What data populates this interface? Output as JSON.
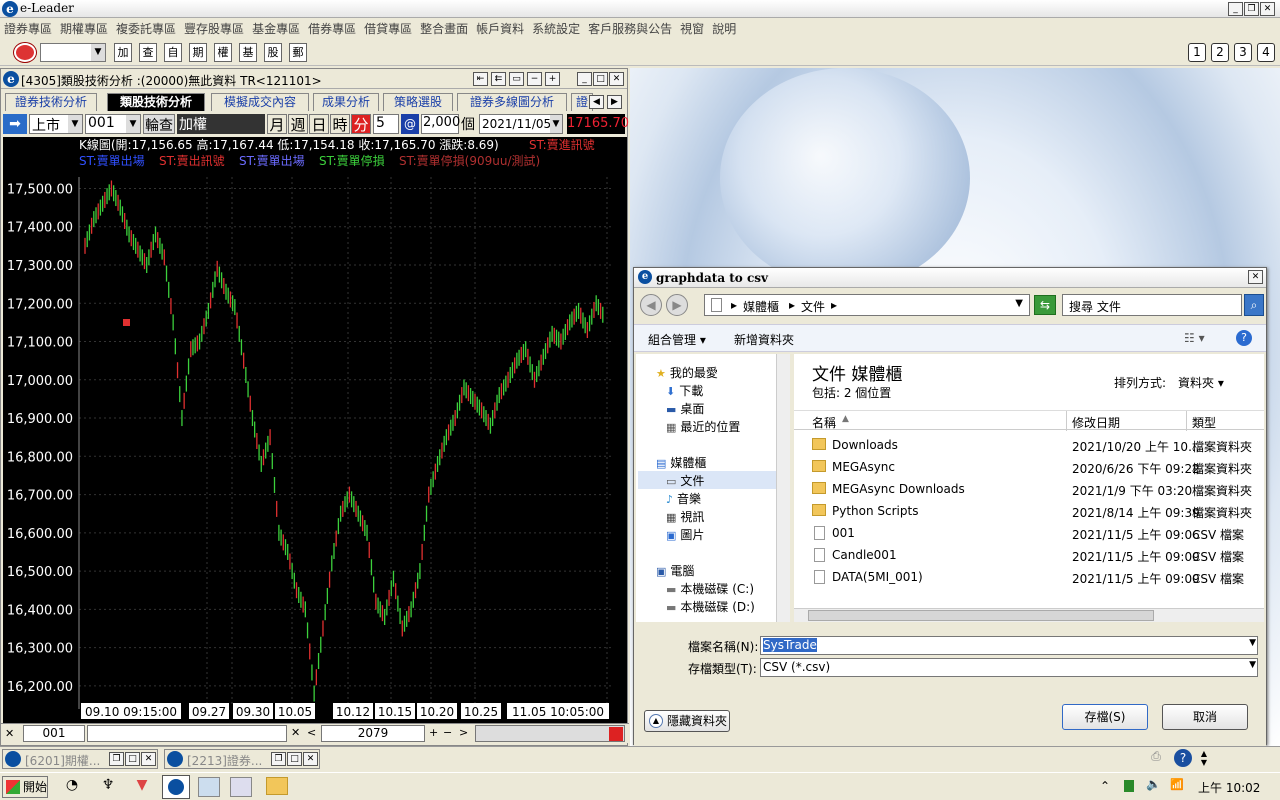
{
  "app": {
    "title": "e-Leader"
  },
  "menu": [
    "證券專區",
    "期權專區",
    "複委託專區",
    "豐存股專區",
    "基金專區",
    "借券專區",
    "借貸專區",
    "整合畫面",
    "帳戶資料",
    "系統設定",
    "客戶服務與公告",
    "視窗",
    "說明"
  ],
  "toolbar": {
    "icons": [
      "加",
      "查",
      "自",
      "期",
      "權",
      "基",
      "股",
      "郵"
    ],
    "numbers": [
      "1",
      "2",
      "3",
      "4"
    ]
  },
  "child": {
    "title": "[4305]類股技術分析 :(20000)無此資料   TR<121101>",
    "tabs": [
      "證券技術分析",
      "類股技術分析",
      "模擬成交內容",
      "成果分析",
      "策略選股",
      "證券多線圖分析",
      "證"
    ],
    "market": "上市",
    "code": "001",
    "rotate": "輪查",
    "index_name": "加權",
    "period_btns": [
      "月",
      "週",
      "日",
      "時",
      "分"
    ],
    "minutes": "5",
    "at": "@",
    "count": "2,000",
    "unit": "個",
    "date": "2021/11/05",
    "price": "17165.70",
    "bottom_code": "001",
    "bottom_num": "2079"
  },
  "chart_data": {
    "type": "line",
    "title": "K線圖(開:17,156.65 高:17,167.44 低:17,154.18 收:17,165.70 漲跌:8.69)",
    "legend": [
      "ST:賣進訊號",
      "ST:賣單出場",
      "ST:賣出訊號",
      "ST:賣單出場",
      "ST:賣單停損",
      "ST:賣單停損(909uu/測試)"
    ],
    "legend_colors": [
      "#e03030",
      "#3050ff",
      "#e03030",
      "#6b6bff",
      "#3cd03c",
      "#b03030"
    ],
    "yticks": [
      "17,500.00",
      "17,400.00",
      "17,300.00",
      "17,200.00",
      "17,100.00",
      "17,000.00",
      "16,900.00",
      "16,800.00",
      "16,700.00",
      "16,600.00",
      "16,500.00",
      "16,400.00",
      "16,300.00",
      "16,200.00"
    ],
    "xticks": [
      "09.10 09:15:00",
      "09.27",
      "09.30",
      "10.05",
      "10.12",
      "10.15",
      "10.20",
      "10.25",
      "11.05 10:05:00"
    ],
    "ylim": [
      16150,
      17530
    ],
    "series": [
      {
        "values": [
          17350,
          17420,
          17460,
          17500,
          17450,
          17380,
          17340,
          17300,
          17380,
          17320,
          17150,
          16900,
          17080,
          17100,
          17180,
          17290,
          17230,
          17190,
          17050,
          16900,
          16780,
          16850,
          16600,
          16550,
          16450,
          16400,
          16180,
          16350,
          16520,
          16650,
          16700,
          16650,
          16600,
          16420,
          16380,
          16480,
          16350,
          16400,
          16500,
          16700,
          16780,
          16850,
          16900,
          16980,
          16950,
          16920,
          16880,
          16960,
          17000,
          17050,
          17080,
          17000,
          17060,
          17120,
          17100,
          17150,
          17180,
          17130,
          17200,
          17160
        ]
      }
    ]
  },
  "dialog": {
    "title": "graphdata to csv",
    "path": [
      "媒體櫃",
      "文件"
    ],
    "search_placeholder": "搜尋 文件",
    "organize": "組合管理",
    "new_folder": "新增資料夾",
    "nav": {
      "favorites": "我的最愛",
      "items_fav": [
        "下載",
        "桌面",
        "最近的位置"
      ],
      "library": "媒體櫃",
      "items_lib": [
        "文件",
        "音樂",
        "視訊",
        "圖片"
      ],
      "computer": "電腦",
      "items_comp": [
        "本機磁碟 (C:)",
        "本機磁碟 (D:)"
      ]
    },
    "lib_title": "文件 媒體櫃",
    "lib_sub": "包括: 2 個位置",
    "sort_label": "排列方式:",
    "sort_value": "資料夾",
    "cols": [
      "名稱",
      "修改日期",
      "類型"
    ],
    "files": [
      {
        "name": "Downloads",
        "date": "2021/10/20 上午 10...",
        "type": "檔案資料夾",
        "kind": "folder"
      },
      {
        "name": "MEGAsync",
        "date": "2020/6/26 下午 09:22",
        "type": "檔案資料夾",
        "kind": "folder"
      },
      {
        "name": "MEGAsync Downloads",
        "date": "2021/1/9 下午 03:20",
        "type": "檔案資料夾",
        "kind": "folder"
      },
      {
        "name": "Python Scripts",
        "date": "2021/8/14 上午 09:39",
        "type": "檔案資料夾",
        "kind": "folder"
      },
      {
        "name": "001",
        "date": "2021/11/5 上午 09:06",
        "type": "CSV 檔案",
        "kind": "csv"
      },
      {
        "name": "Candle001",
        "date": "2021/11/5 上午 09:09",
        "type": "CSV 檔案",
        "kind": "csv"
      },
      {
        "name": "DATA(5MI_001)",
        "date": "2021/11/5 上午 09:09",
        "type": "CSV 檔案",
        "kind": "csv"
      }
    ],
    "filename_label": "檔案名稱(N):",
    "filename_value": "SysTrade",
    "filetype_label": "存檔類型(T):",
    "filetype_value": "CSV (*.csv)",
    "hide_folders": "隱藏資料夾",
    "save": "存檔(S)",
    "cancel": "取消"
  },
  "mdi": [
    {
      "label": "[6201]期權..."
    },
    {
      "label": "[2213]證券..."
    }
  ],
  "taskbar": {
    "start": "開始",
    "time": "上午 10:02"
  }
}
